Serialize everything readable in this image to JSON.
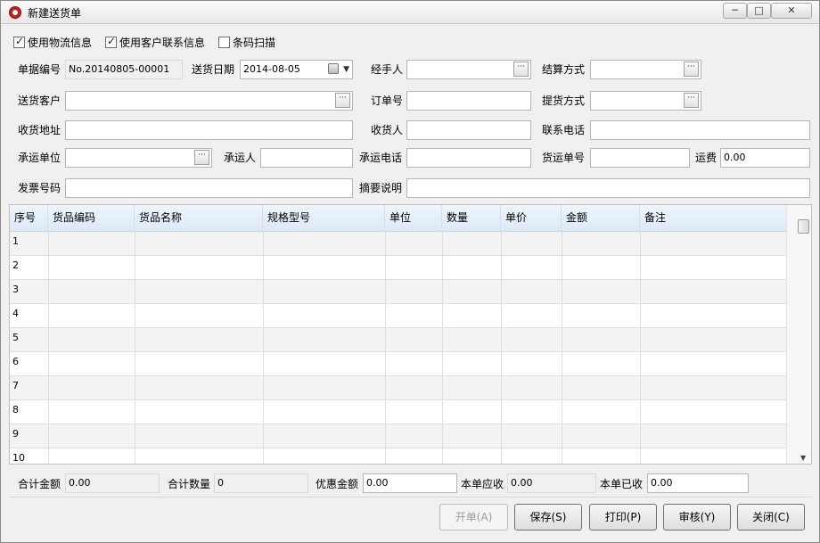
{
  "window": {
    "title": "新建送货单",
    "controls": {
      "minimize": "─",
      "maximize": "□",
      "close": "✕"
    }
  },
  "options": [
    {
      "label": "使用物流信息",
      "checked": true
    },
    {
      "label": "使用客户联系信息",
      "checked": true
    },
    {
      "label": "条码扫描",
      "checked": false
    }
  ],
  "form": {
    "doc_no": {
      "label": "单据编号",
      "value": "No.20140805-00001"
    },
    "delivery_date": {
      "label": "送货日期",
      "value": "2014-08-05"
    },
    "handler": {
      "label": "经手人",
      "value": ""
    },
    "settlement": {
      "label": "结算方式",
      "value": ""
    },
    "customer": {
      "label": "送货客户",
      "value": ""
    },
    "order_no": {
      "label": "订单号",
      "value": ""
    },
    "pickup": {
      "label": "提货方式",
      "value": ""
    },
    "address": {
      "label": "收货地址",
      "value": ""
    },
    "receiver": {
      "label": "收货人",
      "value": ""
    },
    "phone": {
      "label": "联系电话",
      "value": ""
    },
    "carrier": {
      "label": "承运单位",
      "value": ""
    },
    "carrier_person": {
      "label": "承运人",
      "value": ""
    },
    "carrier_phone": {
      "label": "承运电话",
      "value": ""
    },
    "waybill": {
      "label": "货运单号",
      "value": ""
    },
    "freight": {
      "label": "运费",
      "value": "0.00"
    },
    "invoice": {
      "label": "发票号码",
      "value": ""
    },
    "remark": {
      "label": "摘要说明",
      "value": ""
    },
    "ellipsis": "···"
  },
  "grid": {
    "columns": [
      "序号",
      "货品编码",
      "货品名称",
      "规格型号",
      "单位",
      "数量",
      "单价",
      "金额",
      "备注"
    ],
    "rows": [
      "1",
      "2",
      "3",
      "4",
      "5",
      "6",
      "7",
      "8",
      "9",
      "10"
    ],
    "scroll_down": "▼"
  },
  "totals": {
    "total_amount": {
      "label": "合计金额",
      "value": "0.00"
    },
    "total_qty": {
      "label": "合计数量",
      "value": "0"
    },
    "discount": {
      "label": "优惠金额",
      "value": "0.00"
    },
    "receivable": {
      "label": "本单应收",
      "value": "0.00"
    },
    "received": {
      "label": "本单已收",
      "value": "0.00"
    }
  },
  "buttons": {
    "open": "开单(A)",
    "save": "保存(S)",
    "print": "打印(P)",
    "audit": "审核(Y)",
    "close": "关闭(C)"
  }
}
